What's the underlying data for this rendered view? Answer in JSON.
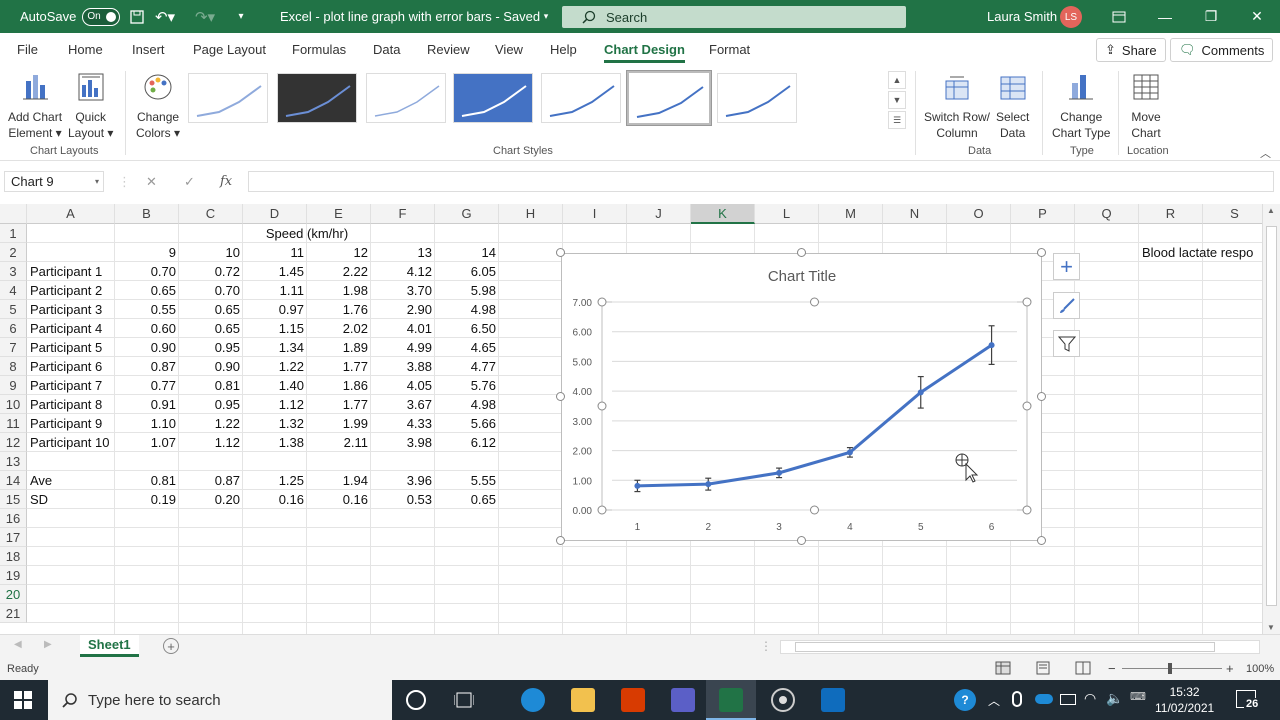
{
  "titlebar": {
    "autosave_label": "AutoSave",
    "autosave_state": "On",
    "doc_title": "Excel - plot line graph with error bars  -  Saved",
    "search_placeholder": "Search",
    "user_name": "Laura Smith",
    "user_initials": "LS"
  },
  "tabs": [
    "File",
    "Home",
    "Insert",
    "Page Layout",
    "Formulas",
    "Data",
    "Review",
    "View",
    "Help",
    "Chart Design",
    "Format"
  ],
  "active_tab": "Chart Design",
  "share_label": "Share",
  "comments_label": "Comments",
  "ribbon": {
    "add_chart_element": [
      "Add Chart",
      "Element ▾"
    ],
    "quick_layout": [
      "Quick",
      "Layout ▾"
    ],
    "change_colors": [
      "Change",
      "Colors ▾"
    ],
    "chart_layouts_group": "Chart Layouts",
    "chart_styles_group": "Chart Styles",
    "switch_row_col": [
      "Switch Row/",
      "Column"
    ],
    "select_data": [
      "Select",
      "Data"
    ],
    "data_group": "Data",
    "change_chart_type": [
      "Change",
      "Chart Type"
    ],
    "type_group": "Type",
    "move_chart": [
      "Move",
      "Chart"
    ],
    "location_group": "Location"
  },
  "formula_bar": {
    "name_box": "Chart 9",
    "fx": "fx",
    "value": ""
  },
  "columns": [
    "A",
    "B",
    "C",
    "D",
    "E",
    "F",
    "G",
    "H",
    "I",
    "J",
    "K",
    "L",
    "M",
    "N",
    "O",
    "P",
    "Q",
    "R",
    "S"
  ],
  "selected_column": "K",
  "rows": [
    "1",
    "2",
    "3",
    "4",
    "5",
    "6",
    "7",
    "8",
    "9",
    "10",
    "11",
    "12",
    "13",
    "14",
    "15",
    "16",
    "17",
    "18",
    "19",
    "20",
    "21"
  ],
  "selected_row": "20",
  "sheet": {
    "header_title": "Speed (km/hr)",
    "speeds": [
      "9",
      "10",
      "11",
      "12",
      "13",
      "14"
    ],
    "participants": [
      {
        "name": "Participant 1",
        "values": [
          "0.70",
          "0.72",
          "1.45",
          "2.22",
          "4.12",
          "6.05"
        ]
      },
      {
        "name": "Participant 2",
        "values": [
          "0.65",
          "0.70",
          "1.11",
          "1.98",
          "3.70",
          "5.98"
        ]
      },
      {
        "name": "Participant 3",
        "values": [
          "0.55",
          "0.65",
          "0.97",
          "1.76",
          "2.90",
          "4.98"
        ]
      },
      {
        "name": "Participant 4",
        "values": [
          "0.60",
          "0.65",
          "1.15",
          "2.02",
          "4.01",
          "6.50"
        ]
      },
      {
        "name": "Participant 5",
        "values": [
          "0.90",
          "0.95",
          "1.34",
          "1.89",
          "4.99",
          "4.65"
        ]
      },
      {
        "name": "Participant 6",
        "values": [
          "0.87",
          "0.90",
          "1.22",
          "1.77",
          "3.88",
          "4.77"
        ]
      },
      {
        "name": "Participant 7",
        "values": [
          "0.77",
          "0.81",
          "1.40",
          "1.86",
          "4.05",
          "5.76"
        ]
      },
      {
        "name": "Participant 8",
        "values": [
          "0.91",
          "0.95",
          "1.12",
          "1.77",
          "3.67",
          "4.98"
        ]
      },
      {
        "name": "Participant 9",
        "values": [
          "1.10",
          "1.22",
          "1.32",
          "1.99",
          "4.33",
          "5.66"
        ]
      },
      {
        "name": "Participant 10",
        "values": [
          "1.07",
          "1.12",
          "1.38",
          "2.11",
          "3.98",
          "6.12"
        ]
      }
    ],
    "ave": {
      "label": "Ave",
      "values": [
        "0.81",
        "0.87",
        "1.25",
        "1.94",
        "3.96",
        "5.55"
      ]
    },
    "sd": {
      "label": "SD",
      "values": [
        "0.19",
        "0.20",
        "0.16",
        "0.16",
        "0.53",
        "0.65"
      ]
    },
    "r2_text": "Blood lactate respo"
  },
  "chart_data": {
    "type": "line",
    "title": "Chart Title",
    "categories": [
      "1",
      "2",
      "3",
      "4",
      "5",
      "6"
    ],
    "series": [
      {
        "values": [
          0.81,
          0.87,
          1.25,
          1.94,
          3.96,
          5.55
        ],
        "error": [
          0.19,
          0.2,
          0.16,
          0.16,
          0.53,
          0.65
        ]
      }
    ],
    "yticks": [
      "0.00",
      "1.00",
      "2.00",
      "3.00",
      "4.00",
      "5.00",
      "6.00",
      "7.00"
    ],
    "ylim": [
      0,
      7
    ],
    "color": "#4472c4",
    "grid": true
  },
  "sheet_tab": "Sheet1",
  "status": {
    "ready": "Ready",
    "zoom": "100%"
  },
  "taskbar": {
    "search_placeholder": "Type here to search",
    "time": "15:32",
    "date": "11/02/2021",
    "notifications": "26"
  },
  "colors": {
    "excel_green": "#217346",
    "series": "#4472c4"
  }
}
